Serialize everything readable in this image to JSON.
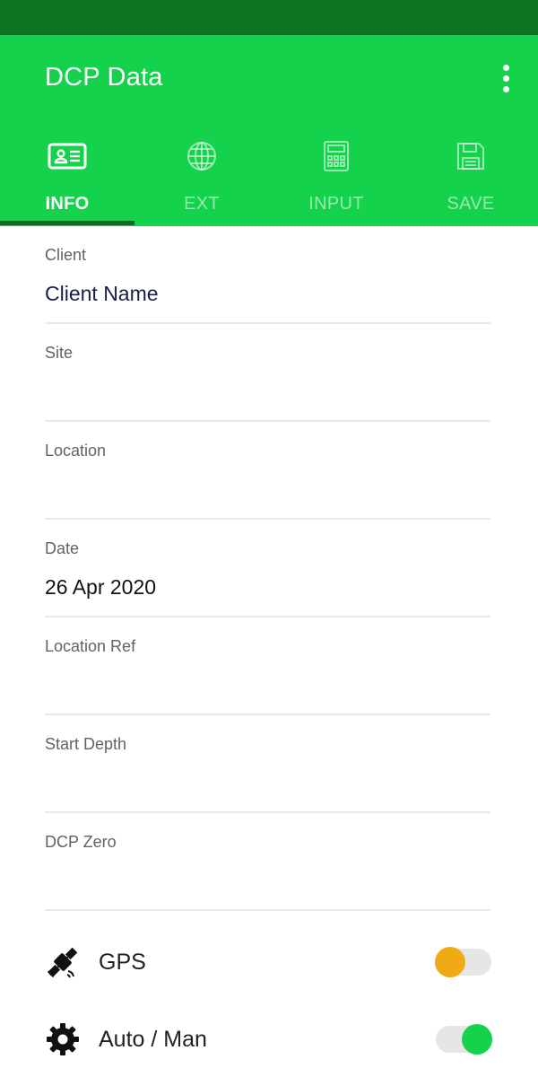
{
  "app": {
    "title": "DCP Data",
    "menu_icon": "more-vertical-icon"
  },
  "colors": {
    "status_bar": "#0e7424",
    "app_bar": "#14d24b",
    "tab_indicator": "#0e6b24",
    "gps_toggle_thumb": "#f0aa14",
    "auto_toggle_thumb": "#14d24b"
  },
  "tabs": [
    {
      "label": "INFO",
      "icon": "id-card-icon",
      "active": true
    },
    {
      "label": "EXT",
      "icon": "globe-icon",
      "active": false
    },
    {
      "label": "INPUT",
      "icon": "calculator-icon",
      "active": false
    },
    {
      "label": "SAVE",
      "icon": "floppy-disk-icon",
      "active": false
    }
  ],
  "fields": [
    {
      "label": "Client",
      "value": "Client Name"
    },
    {
      "label": "Site",
      "value": ""
    },
    {
      "label": "Location",
      "value": ""
    },
    {
      "label": "Date",
      "value": "26 Apr 2020"
    },
    {
      "label": "Location Ref",
      "value": ""
    },
    {
      "label": "Start Depth",
      "value": ""
    },
    {
      "label": "DCP Zero",
      "value": ""
    }
  ],
  "toggles": [
    {
      "label": "GPS",
      "icon": "satellite-icon",
      "on": false
    },
    {
      "label": "Auto / Man",
      "icon": "gear-icon",
      "on": true
    }
  ]
}
